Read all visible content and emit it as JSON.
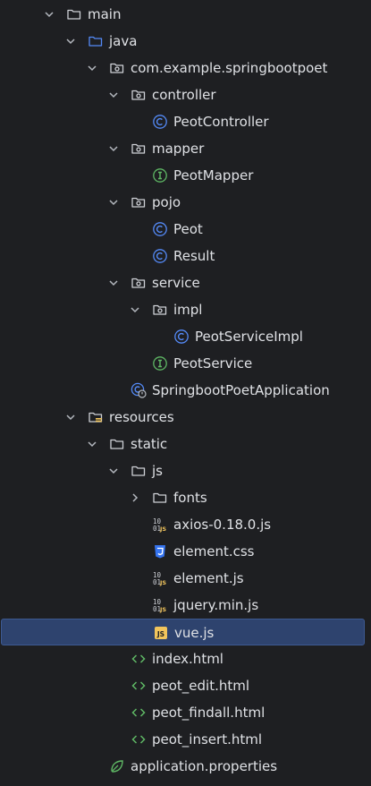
{
  "tree": [
    {
      "label": "main",
      "icon": "folder-icon",
      "arrow": "expanded",
      "depth": 0
    },
    {
      "label": "java",
      "icon": "source-folder-icon",
      "arrow": "expanded",
      "depth": 1
    },
    {
      "label": "com.example.springbootpoet",
      "icon": "package-icon",
      "arrow": "expanded",
      "depth": 2
    },
    {
      "label": "controller",
      "icon": "package-icon",
      "arrow": "expanded",
      "depth": 3
    },
    {
      "label": "PeotController",
      "icon": "class-icon",
      "arrow": "none",
      "depth": 4
    },
    {
      "label": "mapper",
      "icon": "package-icon",
      "arrow": "expanded",
      "depth": 3
    },
    {
      "label": "PeotMapper",
      "icon": "interface-icon",
      "arrow": "none",
      "depth": 4
    },
    {
      "label": "pojo",
      "icon": "package-icon",
      "arrow": "expanded",
      "depth": 3
    },
    {
      "label": "Peot",
      "icon": "class-icon",
      "arrow": "none",
      "depth": 4
    },
    {
      "label": "Result",
      "icon": "class-icon",
      "arrow": "none",
      "depth": 4
    },
    {
      "label": "service",
      "icon": "package-icon",
      "arrow": "expanded",
      "depth": 3
    },
    {
      "label": "impl",
      "icon": "package-icon",
      "arrow": "expanded",
      "depth": 4
    },
    {
      "label": "PeotServiceImpl",
      "icon": "class-icon",
      "arrow": "none",
      "depth": 5
    },
    {
      "label": "PeotService",
      "icon": "interface-icon",
      "arrow": "none",
      "depth": 4
    },
    {
      "label": "SpringbootPoetApplication",
      "icon": "spring-app-class-icon",
      "arrow": "none",
      "depth": 3
    },
    {
      "label": "resources",
      "icon": "resources-folder-icon",
      "arrow": "expanded",
      "depth": 1
    },
    {
      "label": "static",
      "icon": "folder-icon",
      "arrow": "expanded",
      "depth": 2
    },
    {
      "label": "js",
      "icon": "folder-icon",
      "arrow": "expanded",
      "depth": 3
    },
    {
      "label": "fonts",
      "icon": "folder-icon",
      "arrow": "collapsed",
      "depth": 4
    },
    {
      "label": "axios-0.18.0.js",
      "icon": "minified-js-icon",
      "arrow": "none",
      "depth": 4
    },
    {
      "label": "element.css",
      "icon": "css-icon",
      "arrow": "none",
      "depth": 4
    },
    {
      "label": "element.js",
      "icon": "minified-js-icon",
      "arrow": "none",
      "depth": 4
    },
    {
      "label": "jquery.min.js",
      "icon": "minified-js-icon",
      "arrow": "none",
      "depth": 4
    },
    {
      "label": "vue.js",
      "icon": "js-icon",
      "arrow": "none",
      "depth": 4,
      "selected": true
    },
    {
      "label": "index.html",
      "icon": "html-icon",
      "arrow": "none",
      "depth": 3
    },
    {
      "label": "peot_edit.html",
      "icon": "html-icon",
      "arrow": "none",
      "depth": 3
    },
    {
      "label": "peot_findall.html",
      "icon": "html-icon",
      "arrow": "none",
      "depth": 3
    },
    {
      "label": "peot_insert.html",
      "icon": "html-icon",
      "arrow": "none",
      "depth": 3
    },
    {
      "label": "application.properties",
      "icon": "spring-properties-icon",
      "arrow": "none",
      "depth": 2
    }
  ],
  "colors": {
    "background": "#1e1f22",
    "text": "#dfe1e5",
    "selection": "#2e436e",
    "class": "#548af7",
    "interface": "#5fb865",
    "html": "#5fb865",
    "spring": "#5fb865",
    "js": "#f2c55c",
    "css": "#3574f0",
    "folder": "#ced0d6"
  }
}
